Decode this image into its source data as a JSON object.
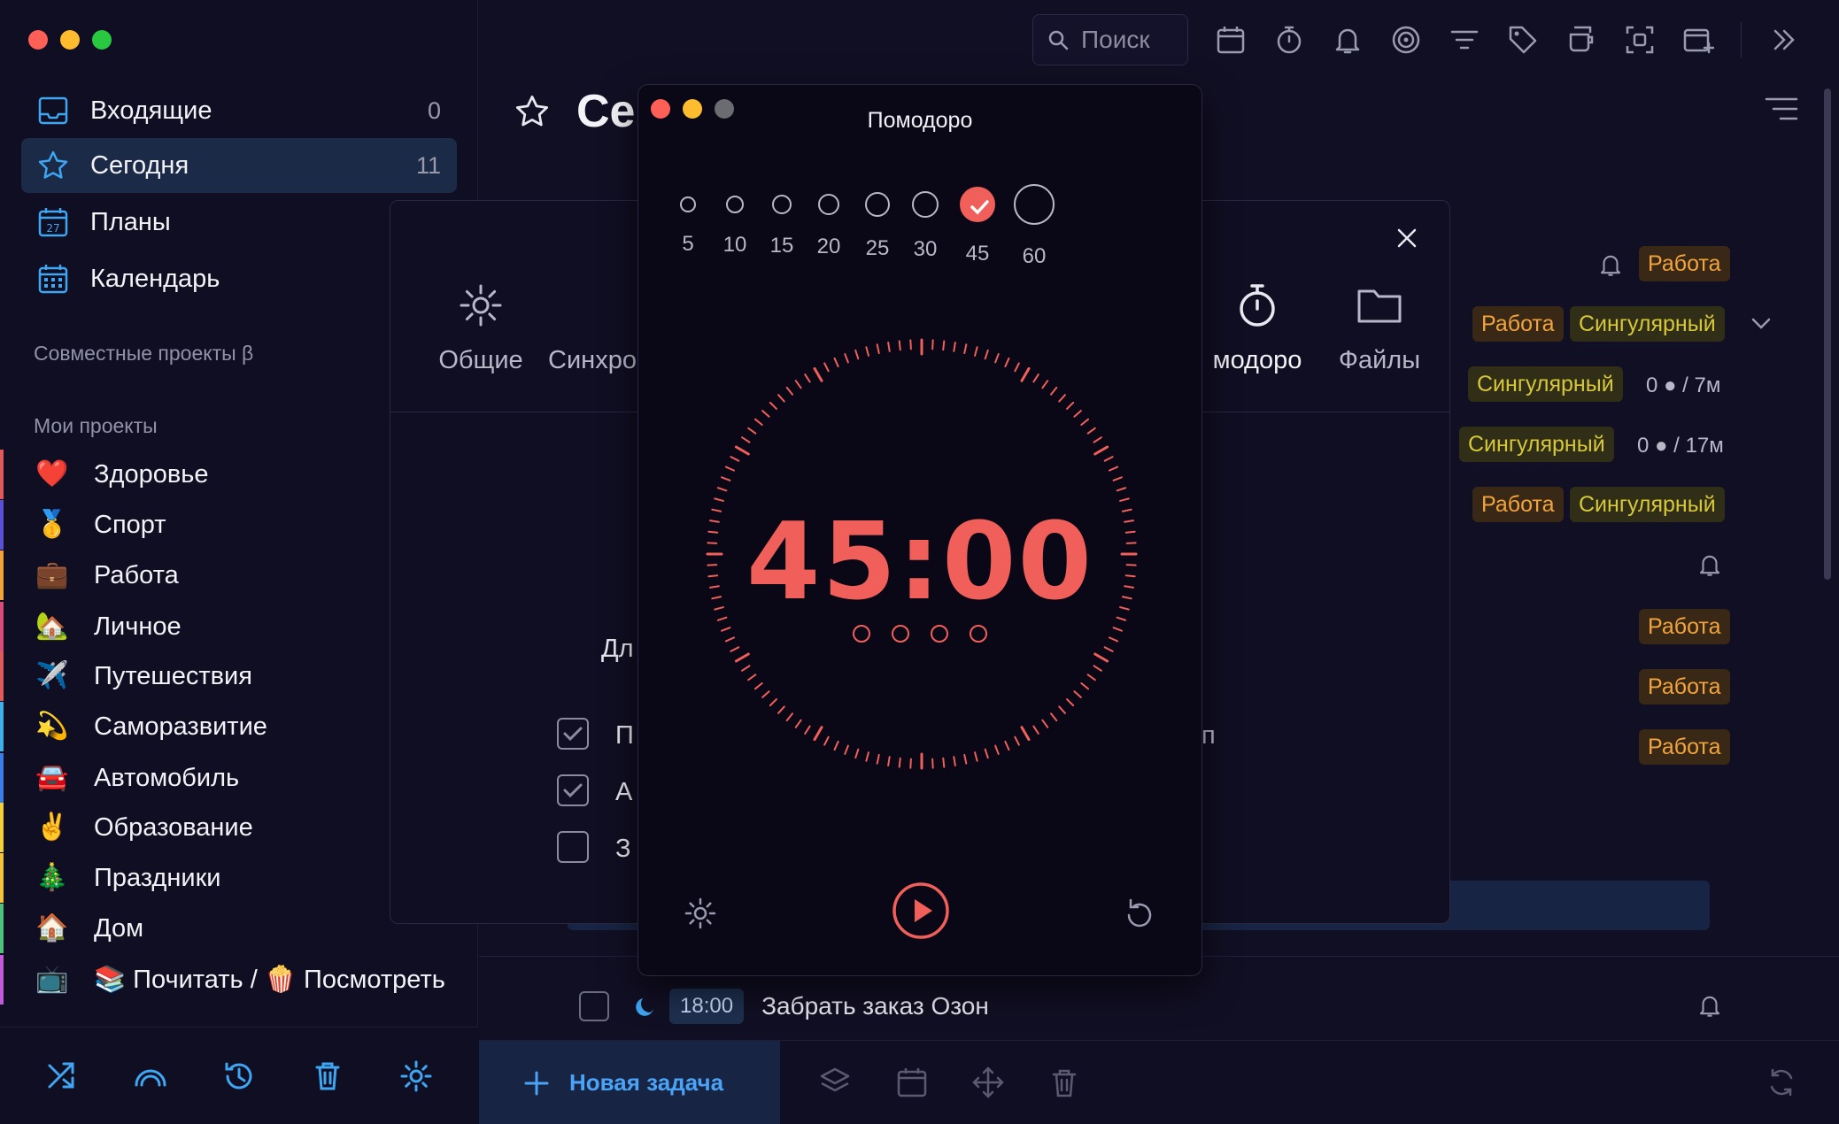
{
  "sidebar": {
    "nav": [
      {
        "label": "Входящие",
        "count": "0"
      },
      {
        "label": "Сегодня",
        "count": "11"
      },
      {
        "label": "Планы",
        "count": ""
      },
      {
        "label": "Календарь",
        "count": ""
      }
    ],
    "shared_projects_label": "Совместные проекты β",
    "my_projects_label": "Мои проекты",
    "projects": [
      {
        "label": "Здоровье",
        "emoji": "❤️",
        "color": "#e05a5a"
      },
      {
        "label": "Спорт",
        "emoji": "🥇",
        "color": "#5b4fd6"
      },
      {
        "label": "Работа",
        "emoji": "💼",
        "color": "#f2a43b"
      },
      {
        "label": "Личное",
        "emoji": "🏡",
        "color": "#d94b7a"
      },
      {
        "label": "Путешествия",
        "emoji": "✈️",
        "color": "#e05a5a"
      },
      {
        "label": "Саморазвитие",
        "emoji": "💫",
        "color": "#3db0e8"
      },
      {
        "label": "Автомобиль",
        "emoji": "🚘",
        "color": "#3b7de8"
      },
      {
        "label": "Образование",
        "emoji": "✌️",
        "color": "#f2d13b"
      },
      {
        "label": "Праздники",
        "emoji": "🎄",
        "color": "#f2c33b"
      },
      {
        "label": "Дом",
        "emoji": "🏠",
        "color": "#4cc27a"
      },
      {
        "label": "📚 Почитать / 🍿 Посмотреть",
        "emoji": "📺",
        "color": "#c25ad9"
      }
    ]
  },
  "main": {
    "search_placeholder": "Поиск",
    "page_title": "Се",
    "tags": {
      "work": "Работа",
      "singular": "Сингулярный"
    },
    "meta_1": "0 ● / 7м",
    "meta_2": "0 ● / 17м",
    "task": {
      "time": "18:00",
      "title": "Забрать заказ Озон"
    },
    "new_task_label": "Новая задача"
  },
  "settings": {
    "tabs": [
      "Общие",
      "Синхро",
      "модоро",
      "Файлы"
    ],
    "partial_label": "Дл",
    "checkbox_labels": [
      "П",
      "А",
      "З"
    ],
    "partial_right": "п"
  },
  "pomodoro": {
    "title": "Помодоро",
    "durations": [
      "5",
      "10",
      "15",
      "20",
      "25",
      "30",
      "45",
      "60"
    ],
    "selected_duration": "45",
    "timer": "45:00",
    "sessions_total": 4,
    "accent": "#f05f5a"
  }
}
